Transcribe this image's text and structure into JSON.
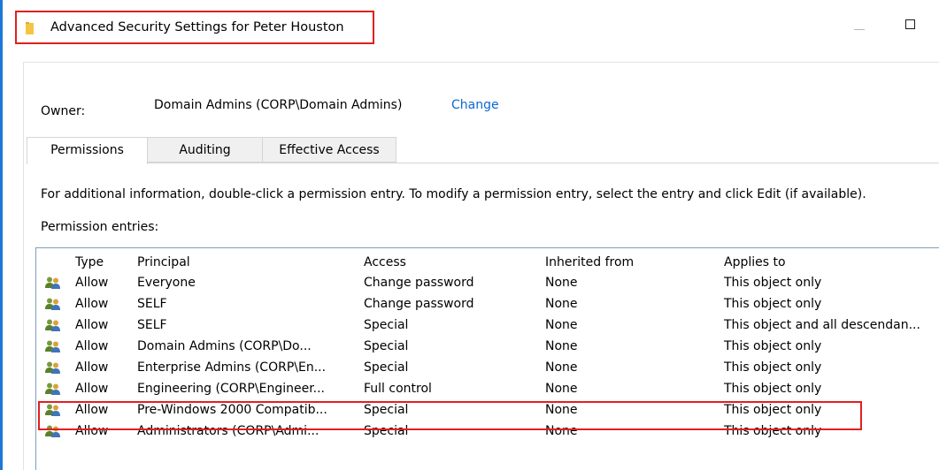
{
  "window": {
    "title": "Advanced Security Settings for Peter Houston"
  },
  "owner": {
    "label": "Owner:",
    "value": "Domain Admins (CORP\\Domain Admins)",
    "change_link": "Change"
  },
  "tabs": [
    {
      "label": "Permissions",
      "selected": true
    },
    {
      "label": "Auditing",
      "selected": false
    },
    {
      "label": "Effective Access",
      "selected": false
    }
  ],
  "info_text": "For additional information, double-click a permission entry. To modify a permission entry, select the entry and click Edit (if available).",
  "entries_label": "Permission entries:",
  "table": {
    "columns": [
      "Type",
      "Principal",
      "Access",
      "Inherited from",
      "Applies to"
    ],
    "rows": [
      {
        "type": "Allow",
        "principal": "Everyone",
        "access": "Change password",
        "inherited": "None",
        "applies": "This object only"
      },
      {
        "type": "Allow",
        "principal": "SELF",
        "access": "Change password",
        "inherited": "None",
        "applies": "This object only"
      },
      {
        "type": "Allow",
        "principal": "SELF",
        "access": "Special",
        "inherited": "None",
        "applies": "This object and all descendan..."
      },
      {
        "type": "Allow",
        "principal": "Domain Admins (CORP\\Do...",
        "access": "Special",
        "inherited": "None",
        "applies": "This object only"
      },
      {
        "type": "Allow",
        "principal": "Enterprise Admins (CORP\\En...",
        "access": "Special",
        "inherited": "None",
        "applies": "This object only"
      },
      {
        "type": "Allow",
        "principal": "Engineering (CORP\\Engineer...",
        "access": "Full control",
        "inherited": "None",
        "applies": "This object only"
      },
      {
        "type": "Allow",
        "principal": "Pre-Windows 2000 Compatib...",
        "access": "Special",
        "inherited": "None",
        "applies": "This object only"
      },
      {
        "type": "Allow",
        "principal": "Administrators (CORP\\Admi...",
        "access": "Special",
        "inherited": "None",
        "applies": "This object only"
      }
    ]
  },
  "colors": {
    "accent_blue": "#1e78d7",
    "link_blue": "#0b6ad0",
    "highlight_red": "#e02020",
    "folder_yellow": "#f4c542"
  }
}
